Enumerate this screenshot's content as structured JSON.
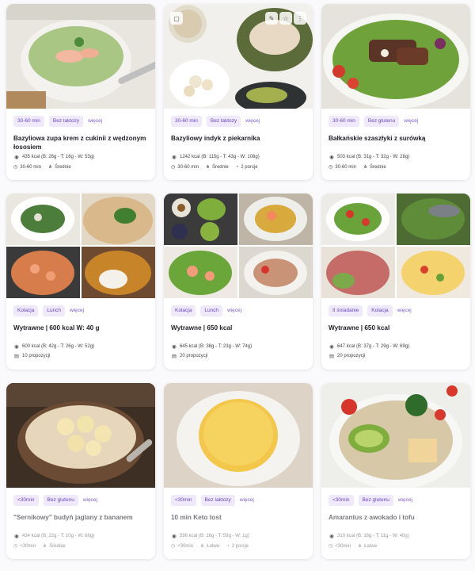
{
  "cards": [
    {
      "tags": [
        "30-60 min",
        "Bez laktozy"
      ],
      "more": "więcej",
      "title": "Bazyliowa zupa krem z cukinii z wędzonym łososiem",
      "nutrition": "435 kcal (B: 26g - T: 16g - W: 53g)",
      "time": "30-60 min",
      "difficulty": "Średnie",
      "portions": ""
    },
    {
      "tags": [
        "30-60 min",
        "Bez laktozy"
      ],
      "more": "więcej",
      "title": "Bazyliowy indyk z piekarnika",
      "nutrition": "1242 kcal (B: 115g - T: 43g - W: 108g)",
      "time": "30-60 min",
      "difficulty": "Średnie",
      "portions": "2 porcje"
    },
    {
      "tags": [
        "30-60 min",
        "Bez glutenu"
      ],
      "more": "więcej",
      "title": "Bałkańskie szaszłyki z surówką",
      "nutrition": "503 kcal (B: 31g - T: 32g - W: 28g)",
      "time": "30-60 min",
      "difficulty": "Średnie",
      "portions": ""
    },
    {
      "tags": [
        "Kolacja",
        "Lunch"
      ],
      "more": "więcej",
      "title": "Wytrawne | 600 kcal W: 40 g",
      "nutrition": "600 kcal (B: 42g - T: 26g - W: 52g)",
      "proposals": "10 propozycji"
    },
    {
      "tags": [
        "Kolacja",
        "Lunch"
      ],
      "more": "więcej",
      "title": "Wytrawne | 650 kcal",
      "nutrition": "645 kcal (B: 38g - T: 23g - W: 74g)",
      "proposals": "20 propozycji"
    },
    {
      "tags": [
        "II śniadanie",
        "Kolacja"
      ],
      "more": "więcej",
      "title": "Wytrawne | 650 kcal",
      "nutrition": "647 kcal (B: 37g - T: 29g - W: 69g)",
      "proposals": "20 propozycji"
    },
    {
      "tags": [
        "<30min",
        "Bez glutenu"
      ],
      "more": "więcej",
      "title": "\"Sernikowy\" budyń jaglany z bananem",
      "nutrition": "434 kcal (B: 22g - T: 10g - W: 66g)",
      "time": "<30min",
      "difficulty": "Średnie",
      "portions": ""
    },
    {
      "tags": [
        "<30min",
        "Bez laktozy"
      ],
      "more": "więcej",
      "title": "10 min Keto tost",
      "nutrition": "598 kcal (B: 16g - T: 59g - W: 1g)",
      "time": "<30min",
      "difficulty": "Łatwe",
      "portions": "2 porcje"
    },
    {
      "tags": [
        "<30min",
        "Bez glutenu"
      ],
      "more": "więcej",
      "title": "Amarantus z awokado i tofu",
      "nutrition": "310 kcal (B: 16g - T: 11g - W: 40g)",
      "time": "<30min",
      "difficulty": "Łatwe",
      "portions": ""
    }
  ]
}
